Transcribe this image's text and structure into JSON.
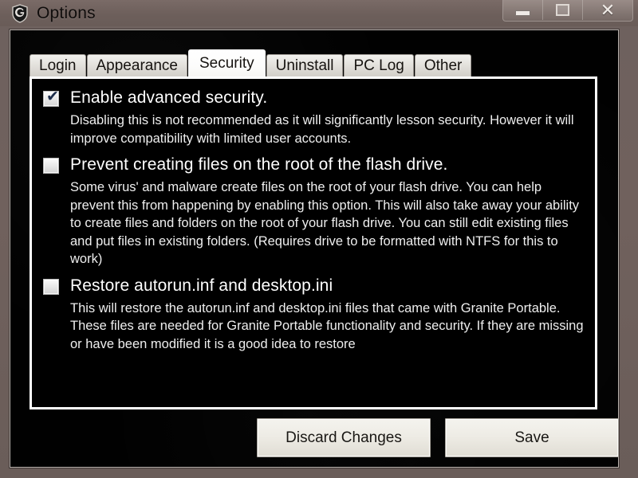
{
  "window": {
    "title": "Options",
    "icon": "granite-shield-icon",
    "controls": {
      "minimize": {
        "name": "minimize-button",
        "glyph": "—"
      },
      "maximize": {
        "name": "maximize-button",
        "glyph": "□"
      },
      "close": {
        "name": "close-button",
        "glyph": "✕"
      }
    }
  },
  "tabs": [
    {
      "id": "login",
      "label": "Login",
      "active": false
    },
    {
      "id": "appearance",
      "label": "Appearance",
      "active": false
    },
    {
      "id": "security",
      "label": "Security",
      "active": true
    },
    {
      "id": "uninstall",
      "label": "Uninstall",
      "active": false
    },
    {
      "id": "pc-log",
      "label": "PC Log",
      "active": false
    },
    {
      "id": "other",
      "label": "Other",
      "active": false
    }
  ],
  "security_panel": {
    "options": [
      {
        "id": "enable-advanced-security",
        "label": "Enable advanced security.",
        "checked": true,
        "check_glyph": "✔",
        "description": "Disabling this is not recommended as it will significantly lesson security. However it will improve compatibility with limited user accounts."
      },
      {
        "id": "prevent-creating-files-on-root",
        "label": "Prevent creating files on the root of the flash drive.",
        "checked": false,
        "check_glyph": "",
        "description": "Some virus' and malware create files on the root of your flash drive. You can help prevent this from happening by enabling this option. This will also take away your ability to create files and folders on the root of your flash drive. You can still edit existing files and put files in existing folders. (Requires drive to be formatted with NTFS for this to work)"
      },
      {
        "id": "restore-autorun-desktop-ini",
        "label": "Restore autorun.inf and desktop.ini",
        "checked": false,
        "check_glyph": "",
        "description": "This will restore the autorun.inf and desktop.ini files that came with Granite Portable. These files are needed for Granite Portable functionality and security. If they are missing or have been modified it is a good idea to restore"
      }
    ]
  },
  "buttons": {
    "discard": "Discard Changes",
    "save": "Save"
  },
  "colors": {
    "titlebar": "#6d5f5b",
    "client_background": "#010101",
    "panel_border": "#ffffff",
    "tab_active": "#ffffff",
    "tab_inactive": "#e3e1dc",
    "text_primary": "#ffffff",
    "button_face": "#eeece5"
  }
}
